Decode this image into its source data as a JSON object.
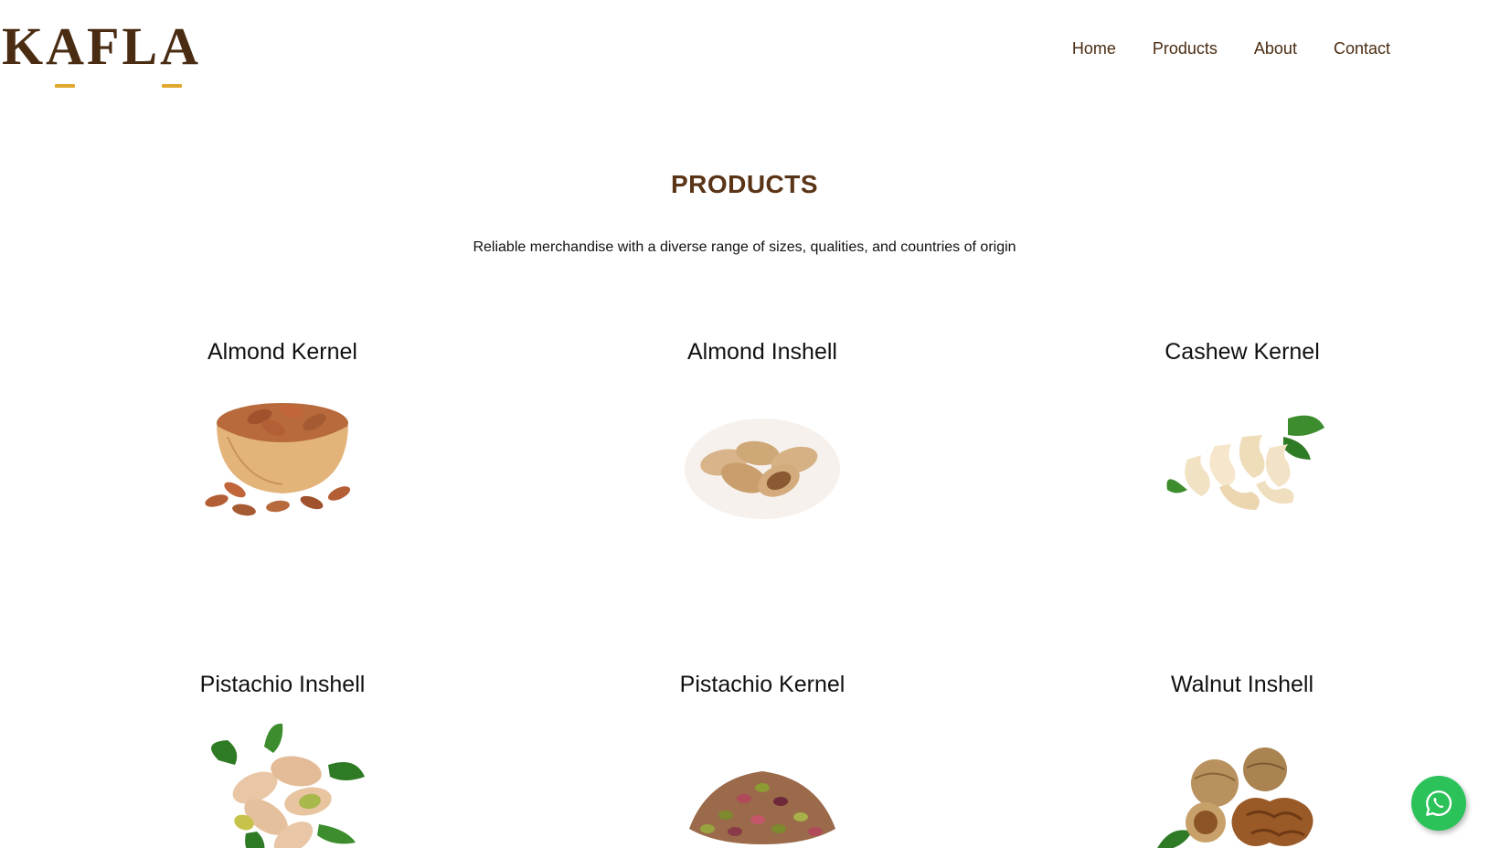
{
  "brand": {
    "logo_text": "KAFLA",
    "accent_color": "#e0a82e",
    "primary_color": "#4a2c12"
  },
  "nav": {
    "items": [
      {
        "label": "Home"
      },
      {
        "label": "Products"
      },
      {
        "label": "About"
      },
      {
        "label": "Contact"
      }
    ]
  },
  "page": {
    "title": "PRODUCTS",
    "subtitle": "Reliable merchandise with a diverse range of sizes, qualities, and countries of origin"
  },
  "products": [
    {
      "name": "Almond Kernel",
      "icon": "almond-kernel-bowl-image"
    },
    {
      "name": "Almond Inshell",
      "icon": "almond-inshell-image"
    },
    {
      "name": "Cashew Kernel",
      "icon": "cashew-kernel-image"
    },
    {
      "name": "Pistachio Inshell",
      "icon": "pistachio-inshell-image"
    },
    {
      "name": "Pistachio Kernel",
      "icon": "pistachio-kernel-image"
    },
    {
      "name": "Walnut Inshell",
      "icon": "walnut-inshell-image"
    }
  ],
  "floating": {
    "whatsapp_icon": "whatsapp-icon",
    "whatsapp_color": "#2bc25a"
  }
}
